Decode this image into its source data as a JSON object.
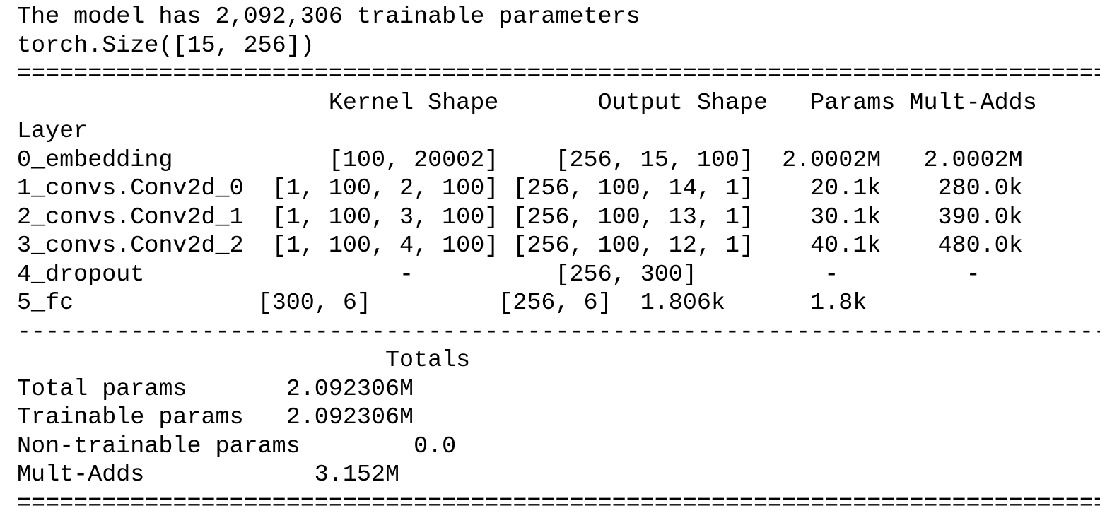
{
  "output": {
    "header_lines": [
      "The model has 2,092,306 trainable parameters",
      "torch.Size([15, 256])"
    ],
    "rule_double": "=============================================================================",
    "rule_single": "-----------------------------------------------------------------------------",
    "table": {
      "columns": [
        "Kernel Shape",
        "Output Shape",
        "Params",
        "Mult-Adds"
      ],
      "index_header": "Layer",
      "rows": [
        {
          "layer": "0_embedding",
          "kernel_shape": "[100, 20002]",
          "output_shape": "[256, 15, 100]",
          "params": "2.0002M",
          "mult_adds": "2.0002M"
        },
        {
          "layer": "1_convs.Conv2d_0",
          "kernel_shape": "[1, 100, 2, 100]",
          "output_shape": "[256, 100, 14, 1]",
          "params": "20.1k",
          "mult_adds": "280.0k"
        },
        {
          "layer": "2_convs.Conv2d_1",
          "kernel_shape": "[1, 100, 3, 100]",
          "output_shape": "[256, 100, 13, 1]",
          "params": "30.1k",
          "mult_adds": "390.0k"
        },
        {
          "layer": "3_convs.Conv2d_2",
          "kernel_shape": "[1, 100, 4, 100]",
          "output_shape": "[256, 100, 12, 1]",
          "params": "40.1k",
          "mult_adds": "480.0k"
        },
        {
          "layer": "4_dropout",
          "kernel_shape": "-",
          "output_shape": "[256, 300]",
          "params": "-",
          "mult_adds": "-"
        },
        {
          "layer": "5_fc",
          "kernel_shape": "[300, 6]",
          "output_shape": "[256, 6]",
          "params": "1.806k",
          "mult_adds": "1.8k"
        }
      ]
    },
    "totals": {
      "header": "Totals",
      "rows": [
        {
          "label": "Total params",
          "value": "2.092306M"
        },
        {
          "label": "Trainable params",
          "value": "2.092306M"
        },
        {
          "label": "Non-trainable params",
          "value": "0.0"
        },
        {
          "label": "Mult-Adds",
          "value": "3.152M"
        }
      ]
    }
  }
}
